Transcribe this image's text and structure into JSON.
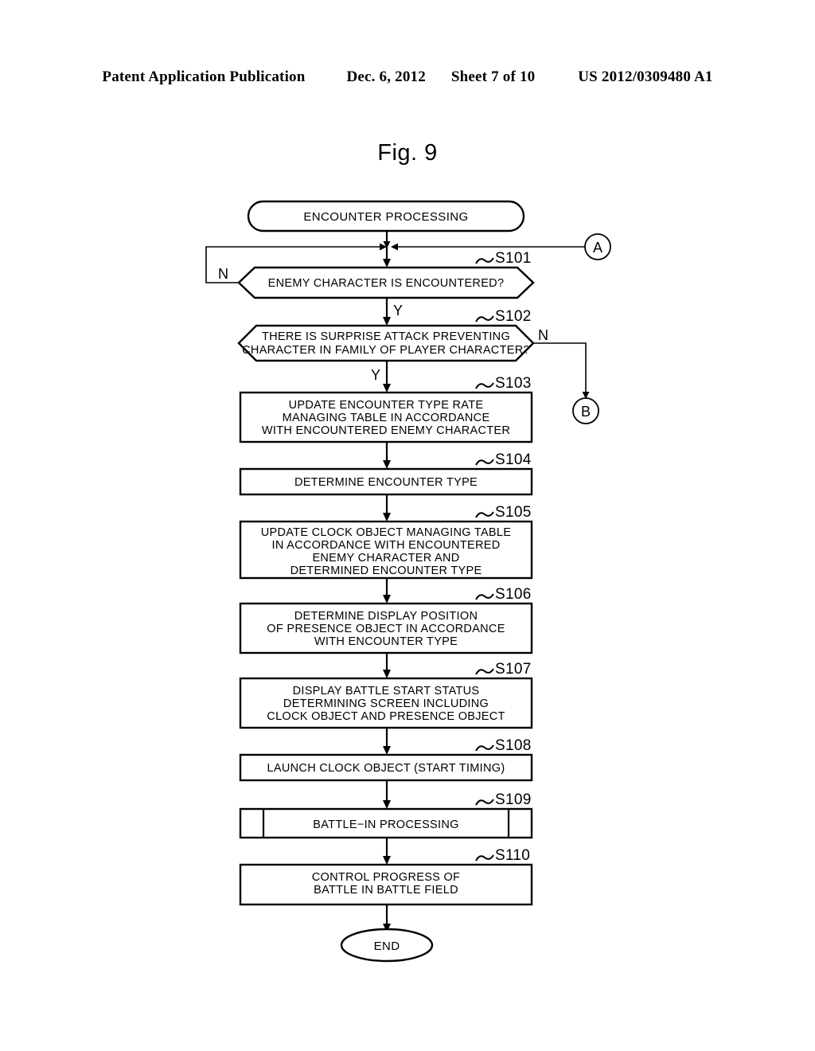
{
  "header": {
    "publication": "Patent Application Publication",
    "date": "Dec. 6, 2012",
    "sheet": "Sheet 7 of 10",
    "doc_number": "US 2012/0309480 A1"
  },
  "figure": {
    "title": "Fig. 9"
  },
  "chart_data": {
    "type": "diagram",
    "title": "Fig. 9",
    "diagram_kind": "flowchart",
    "nodes": [
      {
        "id": "start",
        "shape": "terminator",
        "step": "",
        "text": [
          "ENCOUNTER PROCESSING"
        ]
      },
      {
        "id": "s101",
        "shape": "decision-hexagon",
        "step": "S101",
        "text": [
          "ENEMY CHARACTER IS ENCOUNTERED?"
        ]
      },
      {
        "id": "s102",
        "shape": "decision-hexagon",
        "step": "S102",
        "text": [
          "THERE IS SURPRISE ATTACK PREVENTING",
          "CHARACTER IN FAMILY OF PLAYER CHARACTER?"
        ]
      },
      {
        "id": "s103",
        "shape": "process",
        "step": "S103",
        "text": [
          "UPDATE ENCOUNTER TYPE RATE",
          "MANAGING TABLE IN ACCORDANCE",
          "WITH ENCOUNTERED ENEMY CHARACTER"
        ]
      },
      {
        "id": "s104",
        "shape": "process",
        "step": "S104",
        "text": [
          "DETERMINE ENCOUNTER TYPE"
        ]
      },
      {
        "id": "s105",
        "shape": "process",
        "step": "S105",
        "text": [
          "UPDATE CLOCK OBJECT MANAGING TABLE",
          "IN ACCORDANCE WITH ENCOUNTERED",
          "ENEMY CHARACTER AND",
          "DETERMINED ENCOUNTER TYPE"
        ]
      },
      {
        "id": "s106",
        "shape": "process",
        "step": "S106",
        "text": [
          "DETERMINE DISPLAY POSITION",
          "OF PRESENCE OBJECT IN ACCORDANCE",
          "WITH ENCOUNTER TYPE"
        ]
      },
      {
        "id": "s107",
        "shape": "process",
        "step": "S107",
        "text": [
          "DISPLAY BATTLE START STATUS",
          "DETERMINING SCREEN INCLUDING",
          "CLOCK OBJECT AND PRESENCE OBJECT"
        ]
      },
      {
        "id": "s108",
        "shape": "process",
        "step": "S108",
        "text": [
          "LAUNCH CLOCK OBJECT (START TIMING)"
        ]
      },
      {
        "id": "s109",
        "shape": "predefined-process",
        "step": "S109",
        "text": [
          "BATTLE−IN PROCESSING"
        ]
      },
      {
        "id": "s110",
        "shape": "process",
        "step": "S110",
        "text": [
          "CONTROL PROGRESS OF",
          "BATTLE IN BATTLE FIELD"
        ]
      },
      {
        "id": "end",
        "shape": "terminator-oval",
        "step": "",
        "text": [
          "END"
        ]
      }
    ],
    "connectors": [
      {
        "id": "conn-a",
        "label": "A",
        "shape": "circle",
        "role": "entry-into-main-flow"
      },
      {
        "id": "conn-b",
        "label": "B",
        "shape": "circle",
        "role": "exit-from-s102-no"
      }
    ],
    "branches": [
      {
        "from": "s101",
        "label": "N",
        "side": "left",
        "to": "loop-back-above-s101"
      },
      {
        "from": "s101",
        "label": "Y",
        "side": "bottom",
        "to": "s102"
      },
      {
        "from": "s102",
        "label": "N",
        "side": "right",
        "to": "conn-b"
      },
      {
        "from": "s102",
        "label": "Y",
        "side": "bottom",
        "to": "s103"
      }
    ]
  },
  "nodes": {
    "start": {
      "text": "ENCOUNTER PROCESSING"
    },
    "s101": {
      "step": "S101",
      "l1": "ENEMY CHARACTER IS ENCOUNTERED?"
    },
    "s102": {
      "step": "S102",
      "l1": "THERE IS SURPRISE ATTACK PREVENTING",
      "l2": "CHARACTER IN FAMILY OF PLAYER CHARACTER?"
    },
    "s103": {
      "step": "S103",
      "l1": "UPDATE ENCOUNTER TYPE RATE",
      "l2": "MANAGING TABLE IN ACCORDANCE",
      "l3": "WITH ENCOUNTERED ENEMY CHARACTER"
    },
    "s104": {
      "step": "S104",
      "l1": "DETERMINE ENCOUNTER TYPE"
    },
    "s105": {
      "step": "S105",
      "l1": "UPDATE CLOCK OBJECT MANAGING TABLE",
      "l2": "IN ACCORDANCE WITH ENCOUNTERED",
      "l3": "ENEMY CHARACTER AND",
      "l4": "DETERMINED ENCOUNTER TYPE"
    },
    "s106": {
      "step": "S106",
      "l1": "DETERMINE DISPLAY POSITION",
      "l2": "OF PRESENCE OBJECT IN ACCORDANCE",
      "l3": "WITH ENCOUNTER TYPE"
    },
    "s107": {
      "step": "S107",
      "l1": "DISPLAY BATTLE START STATUS",
      "l2": "DETERMINING SCREEN INCLUDING",
      "l3": "CLOCK OBJECT AND PRESENCE OBJECT"
    },
    "s108": {
      "step": "S108",
      "l1": "LAUNCH CLOCK OBJECT (START TIMING)"
    },
    "s109": {
      "step": "S109",
      "l1": "BATTLE−IN PROCESSING"
    },
    "s110": {
      "step": "S110",
      "l1": "CONTROL PROGRESS OF",
      "l2": "BATTLE IN BATTLE FIELD"
    },
    "end": {
      "text": "END"
    }
  },
  "branch_labels": {
    "s101_n": "N",
    "s101_y": "Y",
    "s102_n": "N",
    "s102_y": "Y"
  },
  "connectors": {
    "a": "A",
    "b": "B"
  },
  "colors": {
    "ink": "#000000",
    "paper": "#ffffff"
  }
}
